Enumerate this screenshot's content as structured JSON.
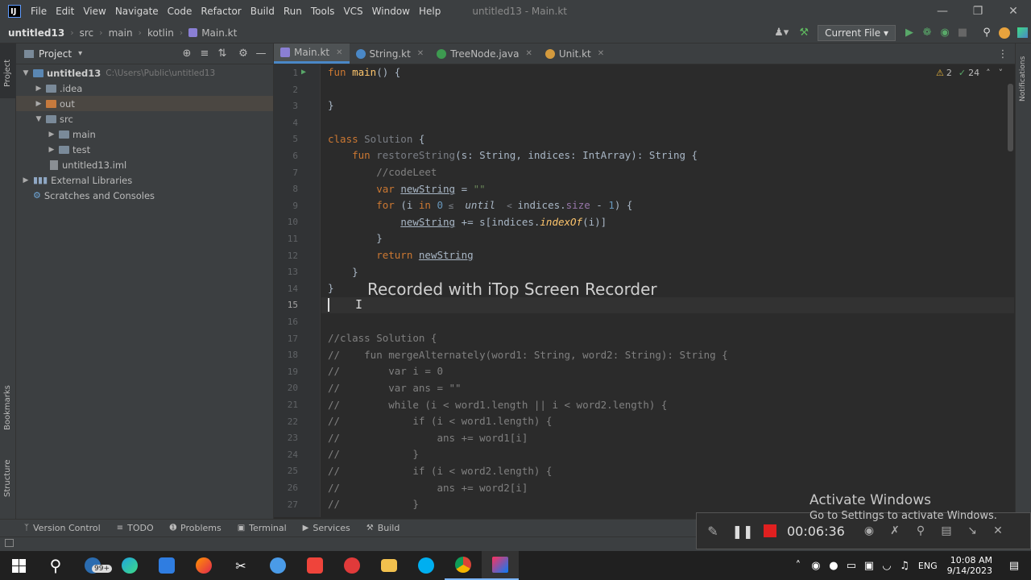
{
  "menu": {
    "items": [
      "File",
      "Edit",
      "View",
      "Navigate",
      "Code",
      "Refactor",
      "Build",
      "Run",
      "Tools",
      "VCS",
      "Window",
      "Help"
    ],
    "window_title": "untitled13 - Main.kt"
  },
  "breadcrumb": [
    "untitled13",
    "src",
    "main",
    "kotlin",
    "Main.kt"
  ],
  "run_config": "Current File",
  "project_panel": {
    "title": "Project",
    "tree": [
      {
        "label": "untitled13",
        "hint": "C:\\Users\\Public\\untitled13",
        "depth": 0,
        "open": true,
        "kind": "folder-blue"
      },
      {
        "label": ".idea",
        "depth": 1,
        "open": false,
        "kind": "folder"
      },
      {
        "label": "out",
        "depth": 1,
        "open": false,
        "kind": "folder-orange",
        "selected": true
      },
      {
        "label": "src",
        "depth": 1,
        "open": true,
        "kind": "folder"
      },
      {
        "label": "main",
        "depth": 2,
        "open": false,
        "kind": "folder"
      },
      {
        "label": "test",
        "depth": 2,
        "open": false,
        "kind": "folder"
      },
      {
        "label": "untitled13.iml",
        "depth": 1,
        "kind": "file"
      },
      {
        "label": "External Libraries",
        "depth": 0,
        "open": false,
        "kind": "lib"
      },
      {
        "label": "Scratches and Consoles",
        "depth": 0,
        "kind": "scratch"
      }
    ]
  },
  "left_strip": {
    "project": "Project",
    "bookmarks": "Bookmarks",
    "structure": "Structure"
  },
  "right_strip": {
    "notifications": "Notifications"
  },
  "tabs": [
    {
      "label": "Main.kt",
      "color": "#8a7fd4",
      "active": true
    },
    {
      "label": "String.kt",
      "color": "#4a88c7",
      "active": false
    },
    {
      "label": "TreeNode.java",
      "color": "#3d9a50",
      "active": false
    },
    {
      "label": "Unit.kt",
      "color": "#d49a3d",
      "active": false
    }
  ],
  "inspections": {
    "warnings": "2",
    "weak": "24"
  },
  "editor": {
    "line_numbers": [
      "1",
      "2",
      "3",
      "4",
      "5",
      "6",
      "7",
      "8",
      "9",
      "10",
      "11",
      "12",
      "13",
      "14",
      "15",
      "16",
      "17",
      "18",
      "19",
      "20",
      "21",
      "22",
      "23",
      "24",
      "25",
      "26",
      "27"
    ],
    "current_line": "15",
    "lines": {
      "l1a": "fun ",
      "l1b": "main",
      "l1c": "() {",
      "l3": "}",
      "l5a": "class ",
      "l5b": "Solution",
      "l5c": " {",
      "l6a": "    fun ",
      "l6b": "restoreString",
      "l6c": "(s: String, indices: IntArray): String {",
      "l7": "        //codeLeet",
      "l8a": "        var ",
      "l8b": "newString",
      "l8c": " = ",
      "l8d": "\"\"",
      "l9a": "        for ",
      "l9b": "(i ",
      "l9c": "in ",
      "l9d": "0",
      "l9e": " ≤ ",
      "l9f": " until ",
      "l9g": " < ",
      "l9h": "indices.",
      "l9i": "size",
      "l9j": " - ",
      "l9k": "1",
      "l9l": ") {",
      "l10a": "            ",
      "l10b": "newString",
      "l10c": " += s[indices.",
      "l10d": "indexOf",
      "l10e": "(i)]",
      "l11": "        }",
      "l12a": "        return ",
      "l12b": "newString",
      "l13": "    }",
      "l14": "}",
      "l17": "//class Solution {",
      "l18": "//    fun mergeAlternately(word1: String, word2: String): String {",
      "l19": "//        var i = 0",
      "l20": "//        var ans = \"\"",
      "l21": "//        while (i < word1.length || i < word2.length) {",
      "l22": "//            if (i < word1.length) {",
      "l23": "//                ans += word1[i]",
      "l24": "//            }",
      "l25": "//            if (i < word2.length) {",
      "l26": "//                ans += word2[i]",
      "l27": "//            }"
    }
  },
  "overlay": {
    "watermark": "Recorded with iTop Screen Recorder",
    "activate_title": "Activate Windows",
    "activate_sub": "Go to Settings to activate Windows.",
    "timer": "00:06:36"
  },
  "bottom_tools": [
    "Version Control",
    "TODO",
    "Problems",
    "Terminal",
    "Services",
    "Build"
  ],
  "taskbar": {
    "mail_badge": "99+",
    "lang": "ENG",
    "time": "10:08 AM",
    "date": "9/14/2023"
  }
}
